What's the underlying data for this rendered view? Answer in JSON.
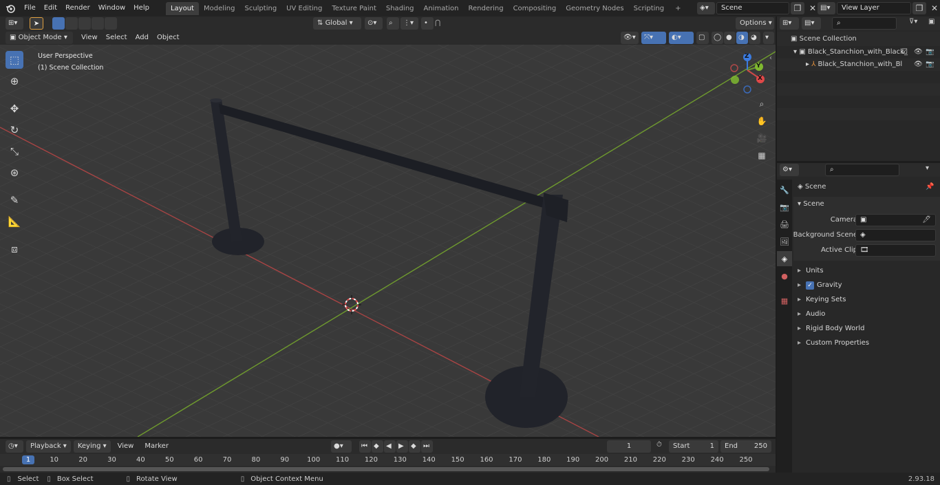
{
  "app": {
    "version": "2.93.18"
  },
  "topbar": {
    "menus": [
      "File",
      "Edit",
      "Render",
      "Window",
      "Help"
    ],
    "workspaces": [
      "Layout",
      "Modeling",
      "Sculpting",
      "UV Editing",
      "Texture Paint",
      "Shading",
      "Animation",
      "Rendering",
      "Compositing",
      "Geometry Nodes",
      "Scripting"
    ],
    "active_workspace": "Layout",
    "add_tab": "+",
    "scene_name": "Scene",
    "view_layer": "View Layer"
  },
  "toolheader": {
    "transform": "Global",
    "options": "Options"
  },
  "viewport_header": {
    "mode": "Object Mode",
    "menus": [
      "View",
      "Select",
      "Add",
      "Object"
    ]
  },
  "viewport": {
    "overlay_line1": "User Perspective",
    "overlay_line2": "(1) Scene Collection",
    "gizmo": {
      "z": "Z",
      "y": "Y",
      "x": "X"
    }
  },
  "outliner": {
    "root": "Scene Collection",
    "items": [
      {
        "label": "Black_Stanchion_with_Black_"
      },
      {
        "label": "Black_Stanchion_with_Bl"
      }
    ]
  },
  "properties": {
    "context": "Scene",
    "section": "Scene",
    "fields": [
      {
        "label": "Camera",
        "value": ""
      },
      {
        "label": "Background Scene",
        "value": ""
      },
      {
        "label": "Active Clip",
        "value": ""
      }
    ],
    "panels": [
      "Units",
      "Gravity",
      "Keying Sets",
      "Audio",
      "Rigid Body World",
      "Custom Properties"
    ],
    "gravity_checked": true
  },
  "timeline": {
    "menus": [
      "Playback",
      "Keying",
      "View",
      "Marker"
    ],
    "current_frame": "1",
    "start_label": "Start",
    "start": "1",
    "end_label": "End",
    "end": "250",
    "ticks": [
      "10",
      "20",
      "30",
      "40",
      "50",
      "60",
      "70",
      "80",
      "90",
      "100",
      "110",
      "120",
      "130",
      "140",
      "150",
      "160",
      "170",
      "180",
      "190",
      "200",
      "210",
      "220",
      "230",
      "240",
      "250"
    ],
    "playhead": "1"
  },
  "statusbar": {
    "select": "Select",
    "box_select": "Box Select",
    "rotate_view": "Rotate View",
    "context_menu": "Object Context Menu"
  },
  "colors": {
    "accent": "#4772b3",
    "x_axis": "#b34545",
    "y_axis": "#6f9b2e",
    "bg": "#393939"
  }
}
